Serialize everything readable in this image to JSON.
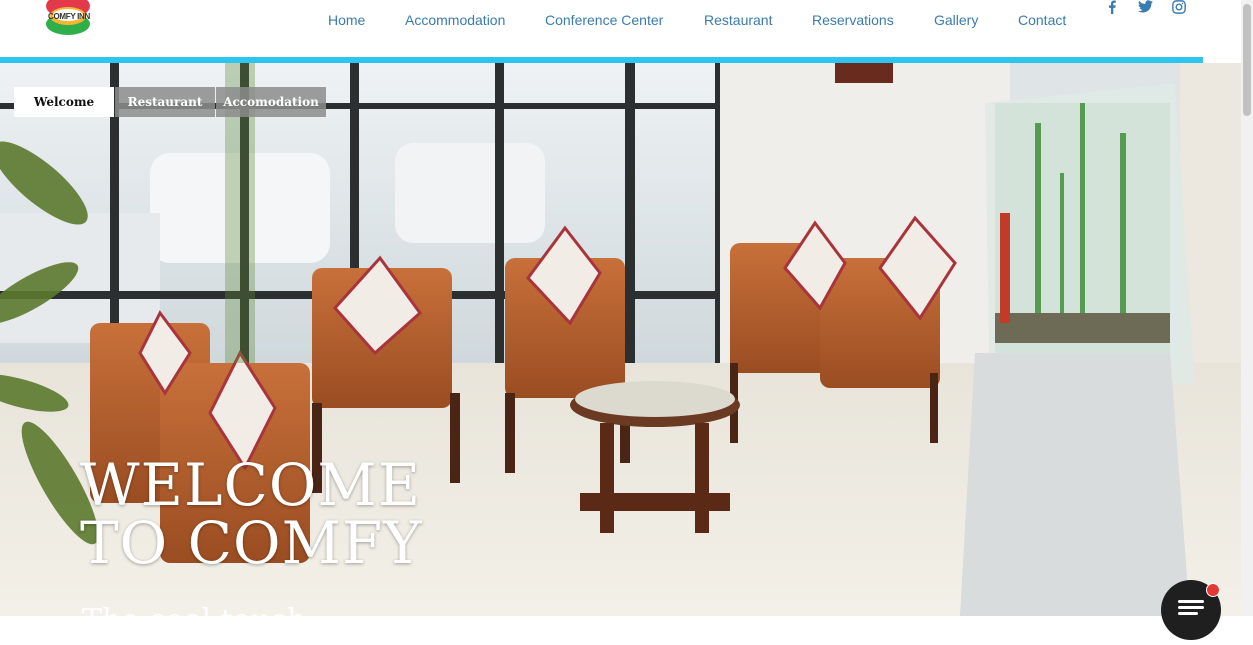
{
  "brand": {
    "logo_text": "COMFY INN"
  },
  "nav": {
    "items": [
      {
        "label": "Home"
      },
      {
        "label": "Accommodation"
      },
      {
        "label": "Conference Center"
      },
      {
        "label": "Restaurant"
      },
      {
        "label": "Reservations"
      },
      {
        "label": "Gallery"
      },
      {
        "label": "Contact"
      }
    ]
  },
  "social": [
    {
      "icon": "facebook-icon"
    },
    {
      "icon": "twitter-icon"
    },
    {
      "icon": "instagram-icon"
    }
  ],
  "colors": {
    "nav_link": "#3a7bb0",
    "accent_bar": "#2ec4f0",
    "chat_badge": "#e53935"
  },
  "hero": {
    "tabs": [
      {
        "label": "Welcome",
        "active": true
      },
      {
        "label": "Restaurant",
        "active": false
      },
      {
        "label": "Accomodation",
        "active": false
      }
    ],
    "title_line1": "WELCOME",
    "title_line2": "TO COMFY",
    "subtitle": "The cool touch"
  },
  "chat": {
    "icon": "chat-icon"
  }
}
